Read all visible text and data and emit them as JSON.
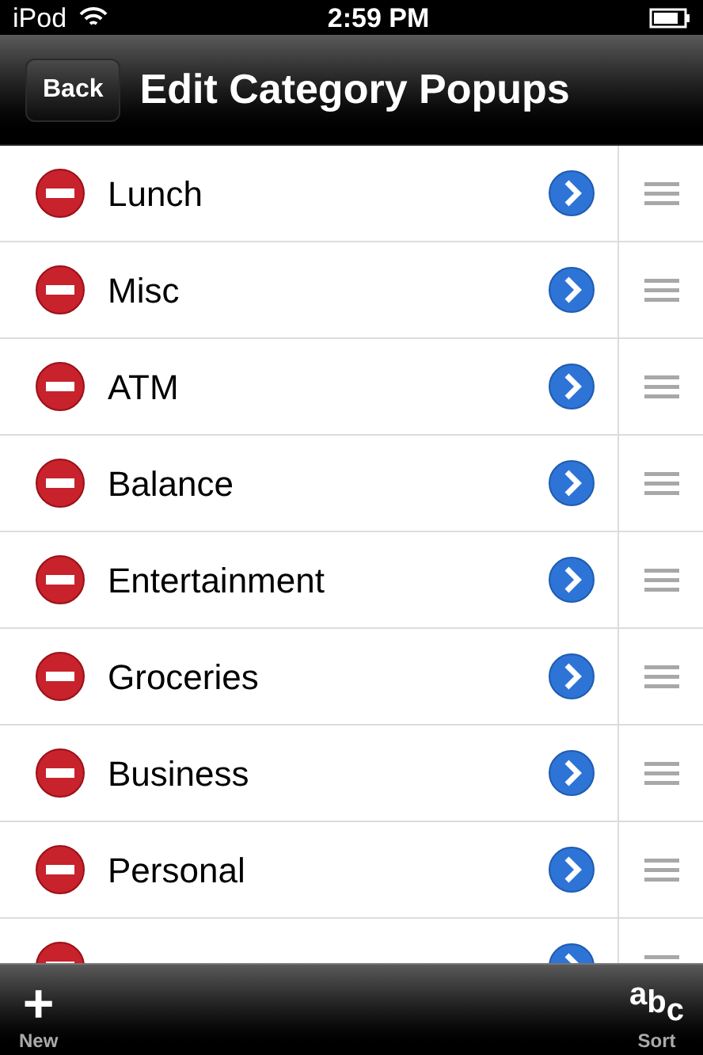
{
  "status_bar": {
    "carrier": "iPod",
    "time": "2:59 PM"
  },
  "nav_bar": {
    "back": "Back",
    "title": "Edit Category Popups"
  },
  "rows": [
    {
      "kind": "full",
      "label": "Lunch"
    },
    {
      "kind": "full",
      "label": "Misc"
    },
    {
      "kind": "full",
      "label": "ATM"
    },
    {
      "kind": "full",
      "label": "Balance"
    },
    {
      "kind": "full",
      "label": "Entertainment"
    },
    {
      "kind": "full",
      "label": "Groceries"
    },
    {
      "kind": "full",
      "label": "Business"
    },
    {
      "kind": "full",
      "label": "Personal"
    },
    {
      "kind": "cut"
    }
  ],
  "toolbar": {
    "new": {
      "icon": "+",
      "label": "New"
    },
    "sort": {
      "icon": "abc",
      "label": "Sort"
    }
  }
}
